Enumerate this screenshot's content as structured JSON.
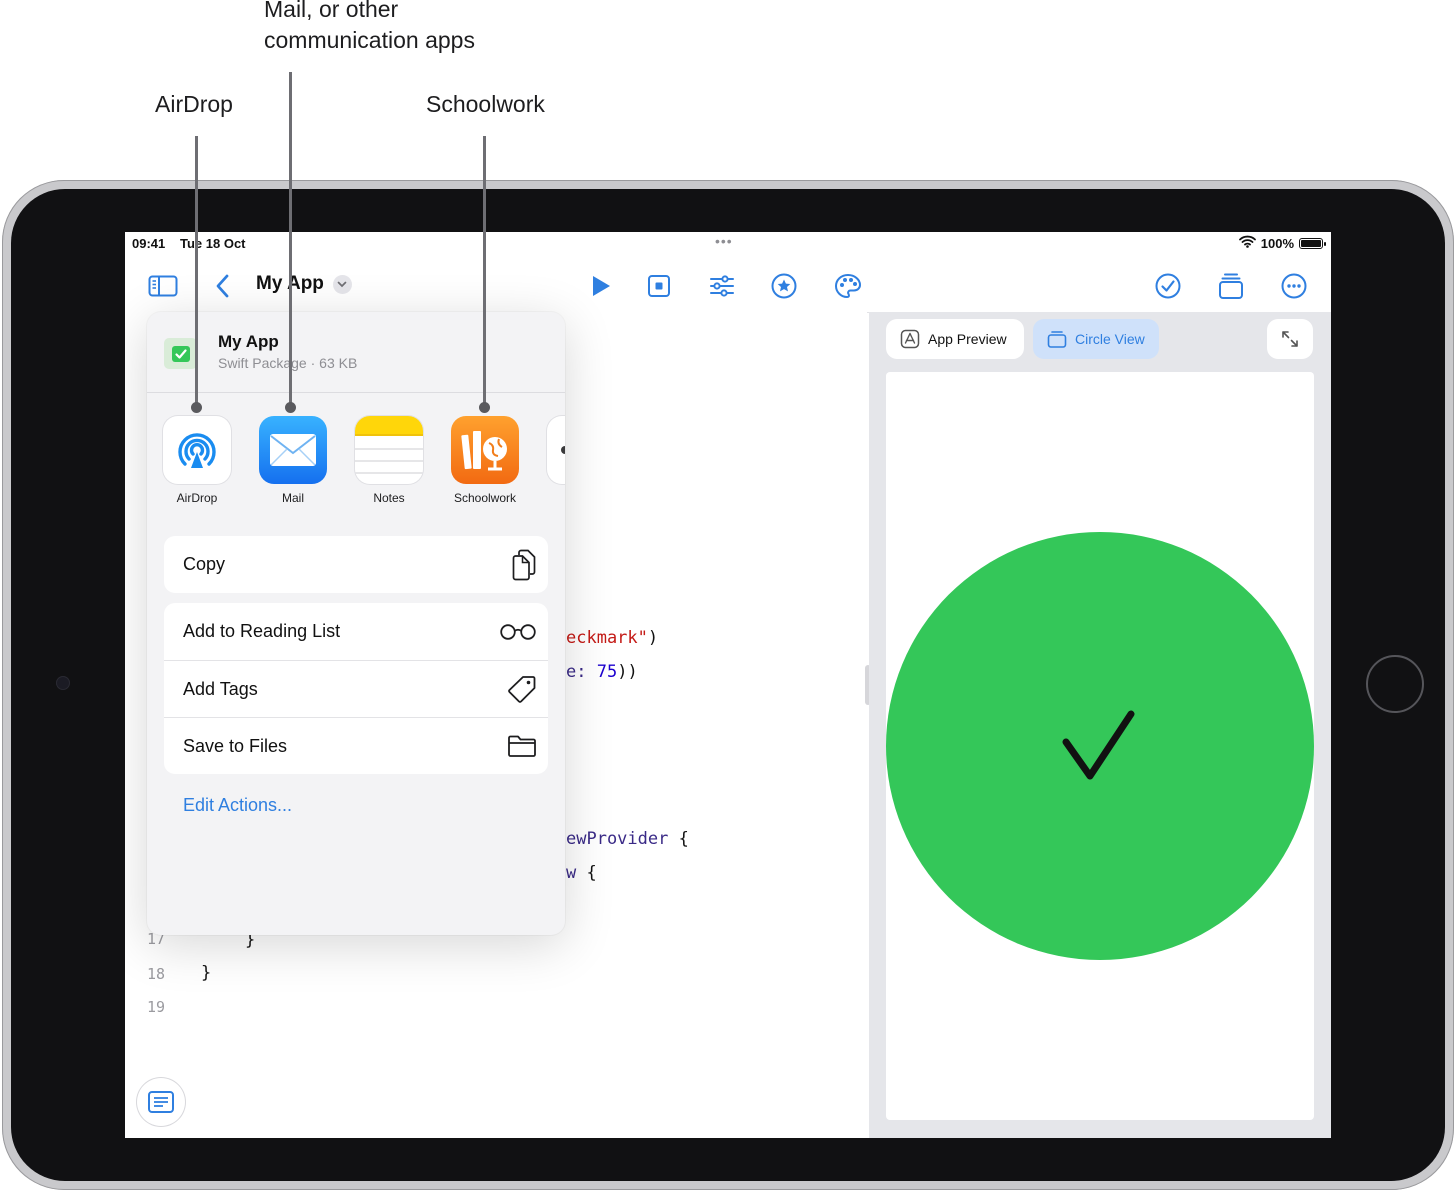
{
  "callouts": {
    "airdrop": "AirDrop",
    "mail_line1": "Mail, or other",
    "mail_line2": "communication apps",
    "schoolwork": "Schoolwork"
  },
  "status_bar": {
    "time": "09:41",
    "date": "Tue 18 Oct",
    "battery": "100%",
    "battery_level": 1.0,
    "multitask_dots": "•••"
  },
  "toolbar": {
    "title": "My App",
    "icons": [
      "sidebar-icon",
      "back-chevron-icon",
      "title-menu-chevron-icon",
      "run-icon",
      "stop-icon",
      "settings-sliders-icon",
      "star-icon",
      "palette-icon",
      "checkmark-circle-icon",
      "window-stack-icon",
      "more-icon"
    ]
  },
  "editor": {
    "line_numbers": [
      "17",
      "18",
      "19"
    ],
    "code_fragments": [
      {
        "text": "eckmark\"",
        "suffix": ")"
      },
      {
        "text": "e: ",
        "value": "75",
        "suffix": "))"
      },
      {
        "text": "ewProvider",
        "suffix": " {"
      },
      {
        "text": "w",
        "suffix": " {"
      },
      {
        "text": "}"
      },
      {
        "text": "}"
      }
    ]
  },
  "share_sheet": {
    "name": "My App",
    "subtitle": "Swift Package · 63 KB",
    "apps": [
      {
        "label": "AirDrop",
        "icon": "airdrop-icon"
      },
      {
        "label": "Mail",
        "icon": "mail-icon"
      },
      {
        "label": "Notes",
        "icon": "notes-icon"
      },
      {
        "label": "Schoolwork",
        "icon": "schoolwork-icon"
      }
    ],
    "actions": {
      "copy": "Copy",
      "reading_list": "Add to Reading List",
      "add_tags": "Add Tags",
      "save_files": "Save to Files"
    },
    "edit_actions": "Edit Actions..."
  },
  "preview": {
    "tab_app_preview": "App Preview",
    "tab_circle_view": "Circle View",
    "circle_color": "#34c759",
    "checkmark_icon": "checkmark-icon"
  },
  "colors": {
    "accent": "#2f7fe0",
    "string": "#c41a16",
    "number": "#1c00cf",
    "type": "#3a2a87"
  }
}
